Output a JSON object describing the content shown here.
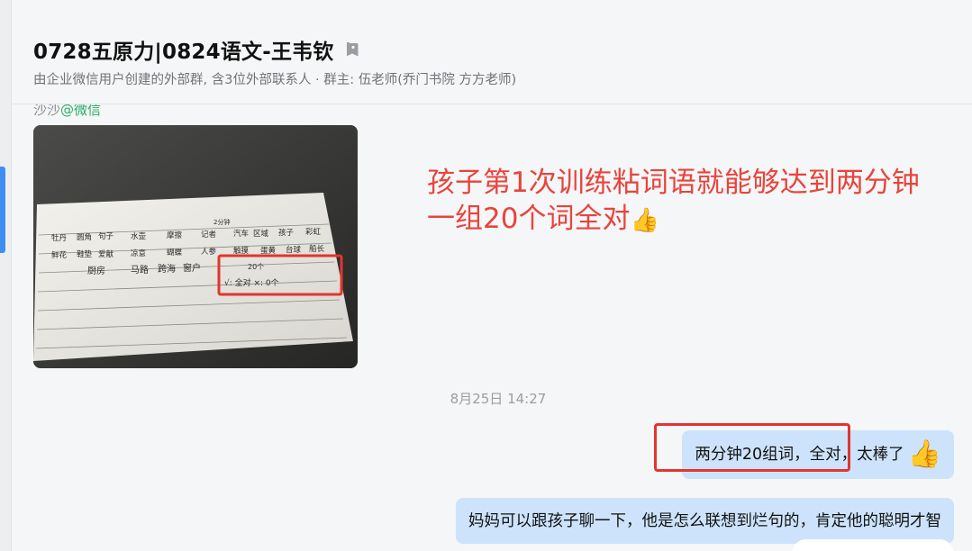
{
  "chat": {
    "title": "0728五原力|0824语文-王韦钦",
    "subtitle": "由企业微信用户创建的外部群, 含3位外部联系人 · 群主: 伍老师(乔门书院 方方老师)"
  },
  "message_group": {
    "sender": "沙沙",
    "sender_platform": "@微信",
    "caption_line1": "孩子第1次训练粘词语就能够达到两分钟",
    "caption_line2": "一组20个词全对",
    "caption_icon": "👍",
    "photo_handwriting": {
      "header": "2分钟",
      "row1": [
        "牡丹",
        "圆角",
        "句子",
        "水壶",
        "摩擦",
        "记者",
        "汽车",
        "区域",
        "孩子",
        "彩虹"
      ],
      "row2": [
        "鲜花",
        "鞋垫",
        "爱献",
        "凉意",
        "蝴蝶",
        "人参",
        "触摸",
        "蛋黄",
        "台球",
        "船长"
      ],
      "row3": [
        "厨房",
        "马路",
        "跨海",
        "窗户"
      ],
      "mark_count": "20个",
      "mark_result": "√: 全对  ×: 0个"
    }
  },
  "timestamp": "8月25日 14:27",
  "outgoing": [
    {
      "text": "两分钟20组词，全对，太棒了",
      "emoji": "👍"
    },
    {
      "text": "妈妈可以跟孩子聊一下，他是怎么联想到烂句的，肯定他的聪明才智"
    }
  ],
  "colors": {
    "accent": "#3d8ef0",
    "bubble": "#cde3fb",
    "annotation_red": "#e3342f",
    "wechat_green": "#2aae67"
  },
  "icons": {
    "tag": "tag-icon",
    "thumbs_up": "thumbs-up-icon"
  }
}
